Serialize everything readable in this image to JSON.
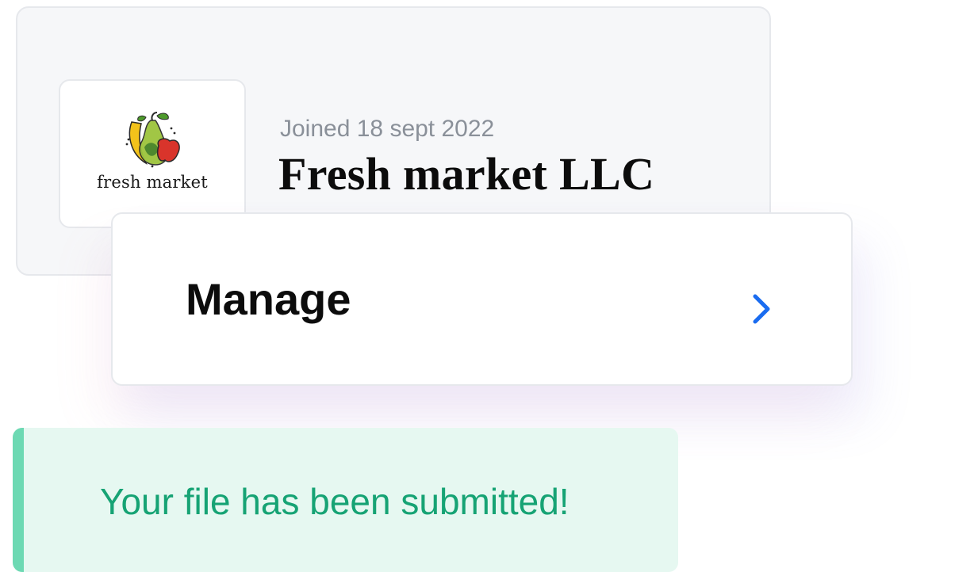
{
  "profile": {
    "logo_text": "fresh market",
    "joined": "Joined 18 sept 2022",
    "company_name": "Fresh market LLC"
  },
  "manage": {
    "label": "Manage",
    "icon": "chevron-right-icon",
    "accent_color": "#1a6cf0"
  },
  "notification": {
    "message": "Your file has been submitted!",
    "type": "success",
    "text_color": "#16a374",
    "background_color": "#e6f8f1",
    "accent_color": "#6dd9b3"
  }
}
